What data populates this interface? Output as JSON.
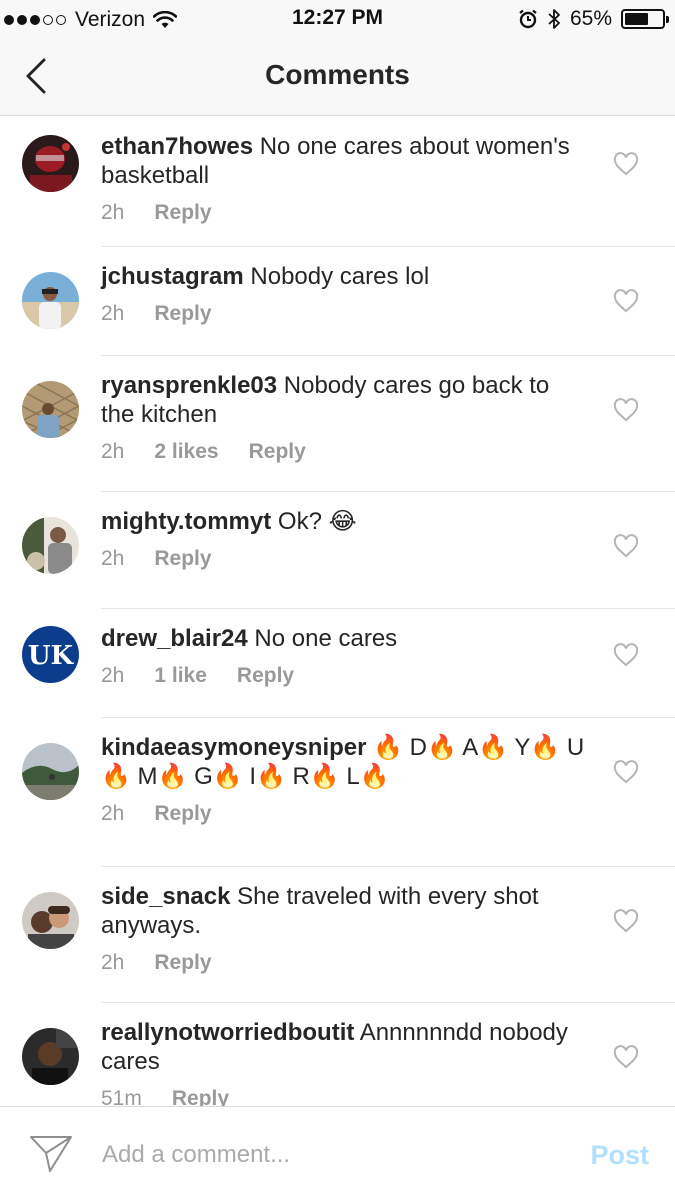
{
  "status_bar": {
    "carrier": "Verizon",
    "time": "12:27 PM",
    "battery_percent": "65%",
    "battery_level": 0.65,
    "signal_bars_filled": 3,
    "signal_bars_total": 5
  },
  "nav": {
    "title": "Comments"
  },
  "comments": [
    {
      "username": "ethan7howes",
      "text": "No one cares about women's basketball",
      "time": "2h",
      "likes": "",
      "reply": "Reply"
    },
    {
      "username": "jchustagram",
      "text": "Nobody cares lol",
      "time": "2h",
      "likes": "",
      "reply": "Reply"
    },
    {
      "username": "ryansprenkle03",
      "text": "Nobody cares go back to the kitchen",
      "time": "2h",
      "likes": "2 likes",
      "reply": "Reply"
    },
    {
      "username": "mighty.tommyt",
      "text": "Ok? 😂",
      "time": "2h",
      "likes": "",
      "reply": "Reply"
    },
    {
      "username": "drew_blair24",
      "text": "No one cares",
      "time": "2h",
      "likes": "1 like",
      "reply": "Reply"
    },
    {
      "username": "kindaeasymoneysniper",
      "text": "🔥 D🔥 A🔥 Y🔥 U🔥 M🔥 G🔥 I🔥 R🔥 L🔥",
      "time": "2h",
      "likes": "",
      "reply": "Reply"
    },
    {
      "username": "side_snack",
      "text": "She traveled with every shot anyways.",
      "time": "2h",
      "likes": "",
      "reply": "Reply"
    },
    {
      "username": "reallynotworriedboutit",
      "text": "Annnnnndd nobody cares",
      "time": "51m",
      "likes": "",
      "reply": "Reply"
    }
  ],
  "composer": {
    "placeholder": "Add a comment...",
    "post_label": "Post"
  },
  "colors": {
    "text": "#262626",
    "meta": "#999999",
    "post_disabled": "#b2dffc",
    "divider": "#e6e6e6"
  },
  "icons": [
    "back-chevron-icon",
    "heart-icon",
    "send-icon",
    "wifi-icon",
    "alarm-icon",
    "bluetooth-icon",
    "battery-icon",
    "fire-emoji-icon",
    "laughing-tears-emoji-icon"
  ]
}
